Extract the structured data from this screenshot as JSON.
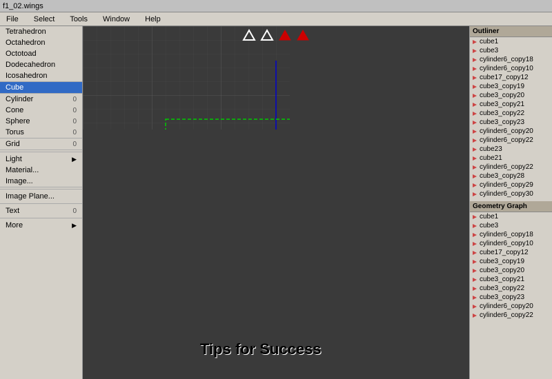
{
  "titlebar": {
    "title": "f1_02.wings"
  },
  "menubar": {
    "items": [
      "File",
      "Select",
      "Tools",
      "Window",
      "Help"
    ]
  },
  "left_menu": {
    "sections": [
      {
        "items": [
          {
            "label": "Tetrahedron",
            "shortcut": "",
            "arrow": ""
          },
          {
            "label": "Octahedron",
            "shortcut": "",
            "arrow": ""
          },
          {
            "label": "Octotoad",
            "shortcut": "",
            "arrow": ""
          },
          {
            "label": "Dodecahedron",
            "shortcut": "",
            "arrow": ""
          },
          {
            "label": "Icosahedron",
            "shortcut": "",
            "arrow": ""
          }
        ]
      },
      {
        "items": [
          {
            "label": "Cube",
            "shortcut": "",
            "arrow": "",
            "active": true
          }
        ]
      },
      {
        "items": [
          {
            "label": "Cylinder",
            "shortcut": "0",
            "arrow": ""
          },
          {
            "label": "Cone",
            "shortcut": "0",
            "arrow": ""
          },
          {
            "label": "Sphere",
            "shortcut": "0",
            "arrow": ""
          },
          {
            "label": "Torus",
            "shortcut": "0",
            "arrow": ""
          }
        ]
      },
      {
        "items": [
          {
            "label": "Grid",
            "shortcut": "0",
            "arrow": ""
          }
        ]
      },
      {
        "items": [
          {
            "label": "Light",
            "shortcut": "",
            "arrow": "▶"
          },
          {
            "label": "Material...",
            "shortcut": "",
            "arrow": ""
          },
          {
            "label": "Image...",
            "shortcut": "",
            "arrow": ""
          }
        ]
      },
      {
        "items": [
          {
            "label": "Image Plane...",
            "shortcut": "",
            "arrow": ""
          }
        ]
      },
      {
        "items": [
          {
            "label": "Text",
            "shortcut": "0",
            "arrow": ""
          }
        ]
      },
      {
        "items": [
          {
            "label": "More",
            "shortcut": "",
            "arrow": "▶"
          }
        ]
      }
    ]
  },
  "outliner": {
    "header": "Outliner",
    "items": [
      "cube1",
      "cube3",
      "cylinder6_copy18",
      "cylinder6_copy10",
      "cube17_copy12",
      "cube3_copy19",
      "cube3_copy20",
      "cube3_copy21",
      "cube3_copy22",
      "cube3_copy23",
      "cylinder6_copy20",
      "cylinder6_copy22",
      "cube23",
      "cube21",
      "cylinder6_copy22",
      "cube3_copy28",
      "cylinder6_copy29",
      "cylinder6_copy30"
    ]
  },
  "geometry_graph": {
    "header": "Geometry Graph",
    "items": [
      "cube1",
      "cube3",
      "cylinder6_copy18",
      "cylinder6_copy10",
      "cube17_copy12",
      "cube3_copy19",
      "cube3_copy20",
      "cube3_copy21",
      "cube3_copy22",
      "cube3_copy23",
      "cylinder6_copy20",
      "cylinder6_copy22"
    ]
  },
  "viewport": {
    "tips_text": "Tips for Success"
  },
  "toolbar_icons": [
    {
      "name": "arrow-left-outline",
      "color": "white"
    },
    {
      "name": "arrow-left-outline",
      "color": "white"
    },
    {
      "name": "arrow-right-filled",
      "color": "red"
    },
    {
      "name": "arrow-right-filled",
      "color": "red"
    }
  ]
}
